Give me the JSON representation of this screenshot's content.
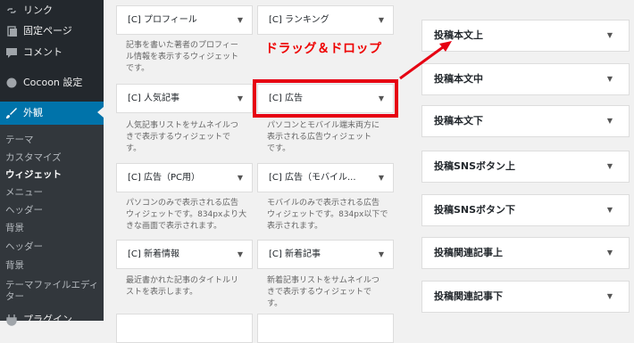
{
  "sidebar": {
    "menu": [
      {
        "label": "リンク"
      },
      {
        "label": "固定ページ"
      },
      {
        "label": "コメント"
      },
      {
        "label": "Cocoon 設定"
      },
      {
        "label": "外観"
      }
    ],
    "submenu": [
      "テーマ",
      "カスタマイズ",
      "ウィジェット",
      "メニュー",
      "ヘッダー",
      "背景",
      "ヘッダー",
      "背景",
      "テーマファイルエディ",
      "ター"
    ],
    "bottom": "プラグイン"
  },
  "widgets": [
    {
      "title": "[C] プロフィール",
      "desc": [
        "記事を書いた著者のプロフィー",
        "ル情報を表示するウィジェット",
        "です。"
      ]
    },
    {
      "title": "[C] ランキング",
      "desc": [
        "",
        "",
        ""
      ]
    },
    {
      "title": "[C] 人気記事",
      "desc": [
        "人気記事リストをサムネイルつ",
        "きで表示するウィジェットで",
        "す。"
      ]
    },
    {
      "title": "[C] 広告",
      "desc": [
        "パソコンとモバイル端末両方に",
        "表示される広告ウィジェット",
        "です。"
      ]
    },
    {
      "title": "[C] 広告（PC用）",
      "desc": [
        "パソコンのみで表示される広告",
        "ウィジェットです。834pxより大",
        "きな画面で表示されます。"
      ]
    },
    {
      "title": "[C] 広告（モバイル...",
      "desc": [
        "モバイルのみで表示される広告",
        "ウィジェットです。834px以下で",
        "表示されます。"
      ]
    },
    {
      "title": "[C] 新着情報",
      "desc": [
        "最近書かれた記事のタイトルリ",
        "ストを表示します。",
        ""
      ]
    },
    {
      "title": "[C] 新着記事",
      "desc": [
        "新着記事リストをサムネイルつ",
        "きで表示するウィジェットで",
        "す。"
      ]
    }
  ],
  "areas": [
    "投稿本文上",
    "投稿本文中",
    "投稿本文下",
    "投稿SNSボタン上",
    "投稿SNSボタン下",
    "投稿関連記事上",
    "投稿関連記事下"
  ],
  "annotation": {
    "callout": "ドラッグ＆ドロップ"
  },
  "colors": {
    "accent": "#0073aa",
    "highlight": "#e60012",
    "callout": "#ee0000"
  }
}
